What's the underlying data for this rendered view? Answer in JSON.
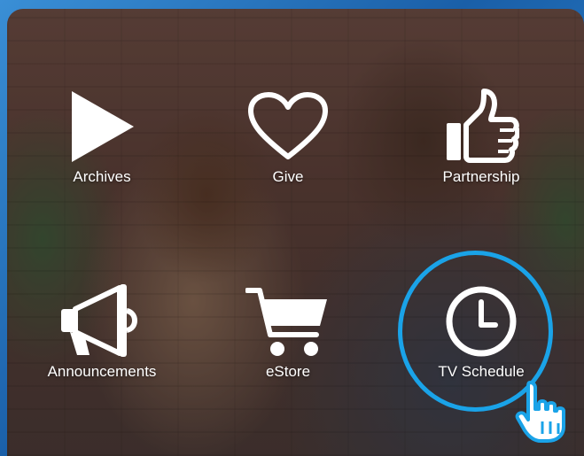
{
  "menu": {
    "items": [
      {
        "label": "Archives",
        "icon": "play-icon"
      },
      {
        "label": "Give",
        "icon": "heart-icon"
      },
      {
        "label": "Partnership",
        "icon": "thumbs-up-icon"
      },
      {
        "label": "Announcements",
        "icon": "megaphone-icon"
      },
      {
        "label": "eStore",
        "icon": "shopping-cart-icon"
      },
      {
        "label": "TV Schedule",
        "icon": "clock-icon"
      }
    ],
    "highlighted": "TV Schedule"
  },
  "colors": {
    "frame_blue": "#2c86d0",
    "highlight_ring": "#1aa3e8",
    "icon_color": "#ffffff"
  }
}
